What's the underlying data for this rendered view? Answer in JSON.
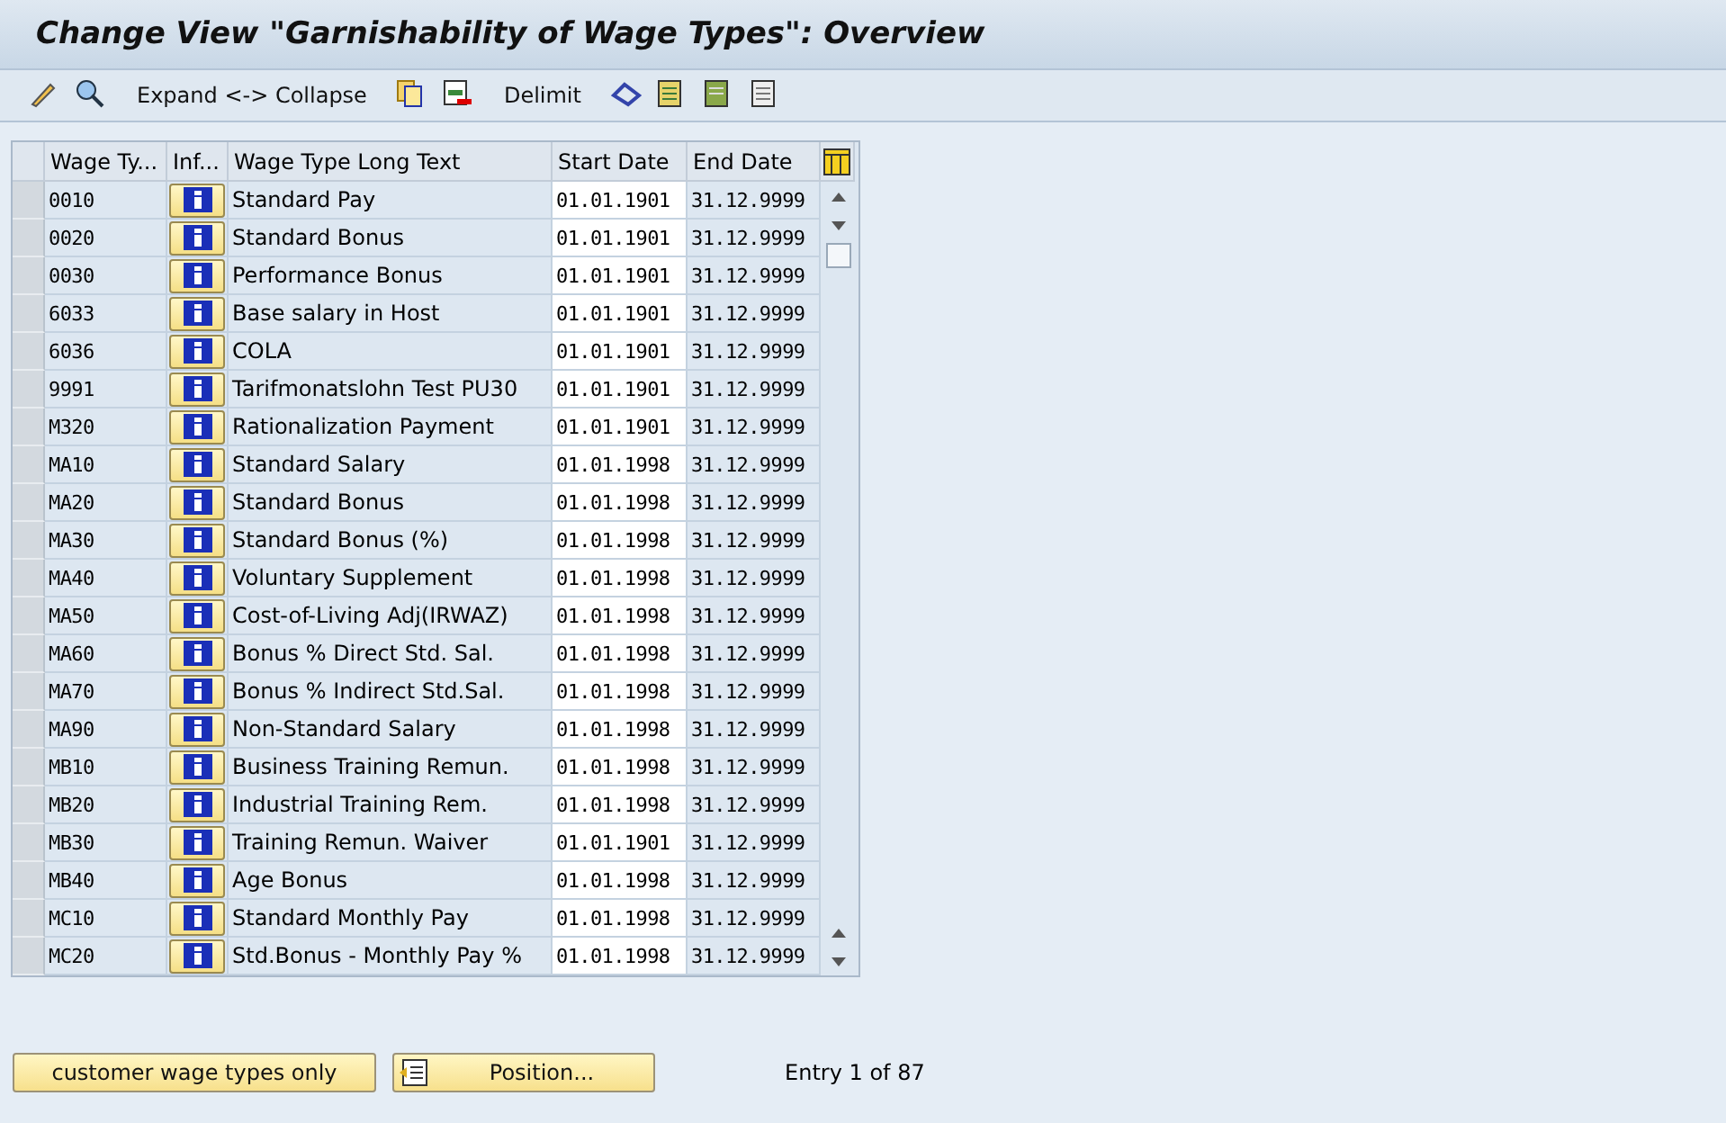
{
  "title": "Change View \"Garnishability of Wage Types\": Overview",
  "toolbar": [
    {
      "kind": "icon"
    },
    {
      "kind": "icon"
    },
    {
      "kind": "text",
      "label": "Expand <-> Collapse"
    },
    {
      "kind": "icon"
    },
    {
      "kind": "icon"
    },
    {
      "kind": "text",
      "label": "Delimit"
    },
    {
      "kind": "icon"
    },
    {
      "kind": "icon"
    },
    {
      "kind": "icon"
    },
    {
      "kind": "icon"
    }
  ],
  "table": {
    "columns": [
      "Wage Ty...",
      "Inf...",
      "Wage Type Long Text",
      "Start Date",
      "End Date"
    ],
    "rows": [
      {
        "code": "0010",
        "text": "Standard Pay",
        "start": "01.01.1901",
        "end": "31.12.9999"
      },
      {
        "code": "0020",
        "text": "Standard Bonus",
        "start": "01.01.1901",
        "end": "31.12.9999"
      },
      {
        "code": "0030",
        "text": "Performance Bonus",
        "start": "01.01.1901",
        "end": "31.12.9999"
      },
      {
        "code": "6033",
        "text": "Base salary in Host",
        "start": "01.01.1901",
        "end": "31.12.9999"
      },
      {
        "code": "6036",
        "text": "COLA",
        "start": "01.01.1901",
        "end": "31.12.9999"
      },
      {
        "code": "9991",
        "text": "Tarifmonatslohn Test PU30",
        "start": "01.01.1901",
        "end": "31.12.9999"
      },
      {
        "code": "M320",
        "text": "Rationalization Payment",
        "start": "01.01.1901",
        "end": "31.12.9999"
      },
      {
        "code": "MA10",
        "text": "Standard Salary",
        "start": "01.01.1998",
        "end": "31.12.9999"
      },
      {
        "code": "MA20",
        "text": "Standard Bonus",
        "start": "01.01.1998",
        "end": "31.12.9999"
      },
      {
        "code": "MA30",
        "text": "Standard Bonus (%)",
        "start": "01.01.1998",
        "end": "31.12.9999"
      },
      {
        "code": "MA40",
        "text": "Voluntary Supplement",
        "start": "01.01.1998",
        "end": "31.12.9999"
      },
      {
        "code": "MA50",
        "text": "Cost-of-Living Adj(IRWAZ)",
        "start": "01.01.1998",
        "end": "31.12.9999"
      },
      {
        "code": "MA60",
        "text": "Bonus % Direct Std. Sal.",
        "start": "01.01.1998",
        "end": "31.12.9999"
      },
      {
        "code": "MA70",
        "text": "Bonus % Indirect Std.Sal.",
        "start": "01.01.1998",
        "end": "31.12.9999"
      },
      {
        "code": "MA90",
        "text": "Non-Standard Salary",
        "start": "01.01.1998",
        "end": "31.12.9999"
      },
      {
        "code": "MB10",
        "text": "Business Training Remun.",
        "start": "01.01.1998",
        "end": "31.12.9999"
      },
      {
        "code": "MB20",
        "text": "Industrial Training Rem.",
        "start": "01.01.1998",
        "end": "31.12.9999"
      },
      {
        "code": "MB30",
        "text": "Training Remun. Waiver",
        "start": "01.01.1901",
        "end": "31.12.9999"
      },
      {
        "code": "MB40",
        "text": "Age Bonus",
        "start": "01.01.1998",
        "end": "31.12.9999"
      },
      {
        "code": "MC10",
        "text": "Standard Monthly Pay",
        "start": "01.01.1998",
        "end": "31.12.9999"
      },
      {
        "code": "MC20",
        "text": "Std.Bonus - Monthly Pay %",
        "start": "01.01.1998",
        "end": "31.12.9999"
      }
    ]
  },
  "buttons": [
    {
      "label": "customer wage types only",
      "kind": "plain"
    },
    {
      "label": "Position...",
      "kind": "position"
    }
  ],
  "entry": "Entry 1 of 87"
}
